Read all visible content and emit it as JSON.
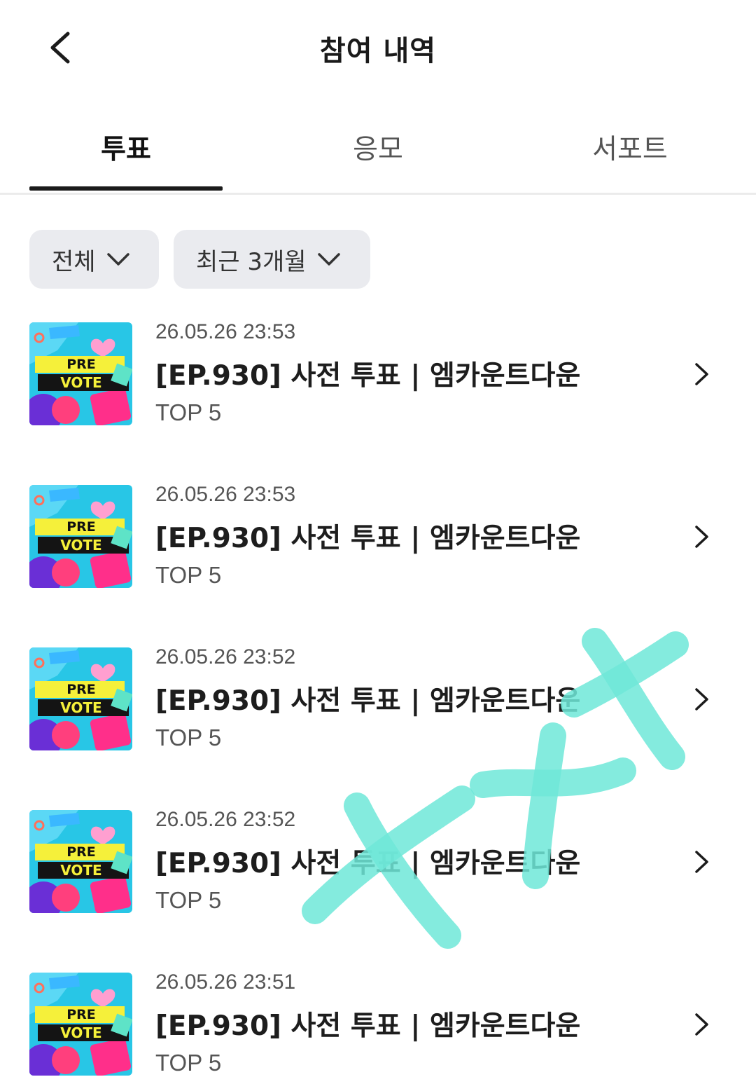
{
  "header": {
    "title": "참여 내역"
  },
  "tabs": [
    {
      "label": "투표",
      "active": true
    },
    {
      "label": "응모",
      "active": false
    },
    {
      "label": "서포트",
      "active": false
    }
  ],
  "filters": [
    {
      "label": "전체"
    },
    {
      "label": "최근 3개월"
    }
  ],
  "items": [
    {
      "date": "26.05.26 23:53",
      "title": "[EP.930] 사전 투표 | 엠카운트다운",
      "sub": "TOP 5"
    },
    {
      "date": "26.05.26 23:53",
      "title": "[EP.930] 사전 투표 | 엠카운트다운",
      "sub": "TOP 5"
    },
    {
      "date": "26.05.26 23:52",
      "title": "[EP.930] 사전 투표 | 엠카운트다운",
      "sub": "TOP 5"
    },
    {
      "date": "26.05.26 23:52",
      "title": "[EP.930] 사전 투표 | 엠카운트다운",
      "sub": "TOP 5"
    },
    {
      "date": "26.05.26 23:51",
      "title": "[EP.930] 사전 투표 | 엠카운트다운",
      "sub": "TOP 5"
    }
  ],
  "thumbnail": {
    "line1": "PRE",
    "line2": "VOTE"
  },
  "colors": {
    "accent": "#1b1b1b",
    "chip_bg": "#eaebef",
    "scribble": "#6fe8d8"
  }
}
